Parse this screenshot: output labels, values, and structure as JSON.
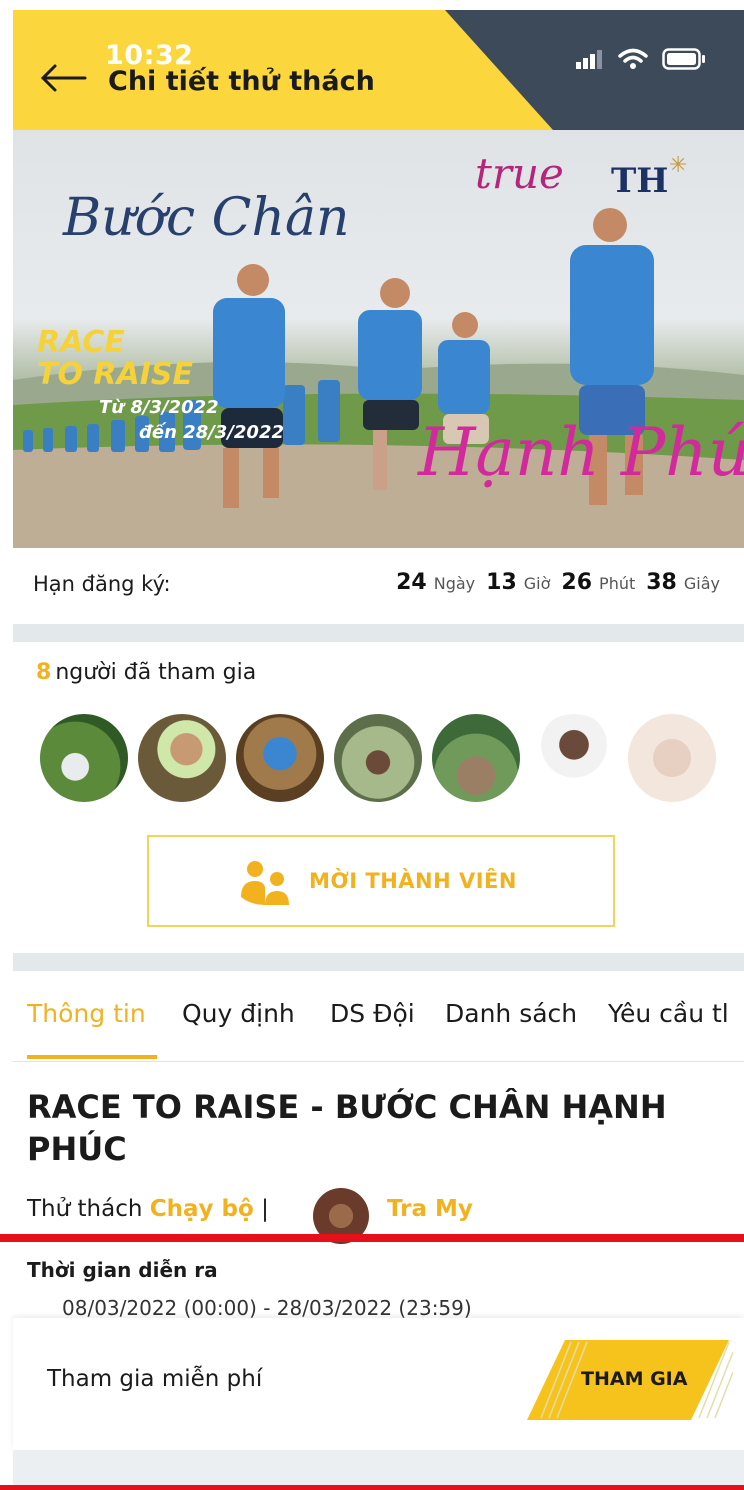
{
  "status_bar": {
    "time": "10:32"
  },
  "header": {
    "title": "Chi tiết thử thách"
  },
  "banner": {
    "title_script": "Bước Chân",
    "subtitle_script": "Hạnh Phúc",
    "race_line1": "RACE",
    "race_line2": "TO RAISE",
    "date_from": "Từ 8/3/2022",
    "date_to": "đến 28/3/2022",
    "logo_left": "true",
    "logo_right": "TH"
  },
  "countdown": {
    "label": "Hạn đăng ký:",
    "days": "24",
    "days_unit": "Ngày",
    "hours": "13",
    "hours_unit": "Giờ",
    "minutes": "26",
    "minutes_unit": "Phút",
    "seconds": "38",
    "seconds_unit": "Giây"
  },
  "participants": {
    "count": "8",
    "label": "người đã tham gia",
    "invite_label": "MỜI THÀNH VIÊN"
  },
  "tabs": [
    {
      "label": "Thông tin",
      "active": true
    },
    {
      "label": "Quy định",
      "active": false
    },
    {
      "label": "DS Đội",
      "active": false
    },
    {
      "label": "Danh sách",
      "active": false
    },
    {
      "label": "Yêu cầu tl",
      "active": false
    }
  ],
  "challenge": {
    "title": "RACE TO RAISE - BƯỚC CHÂN HẠNH PHÚC",
    "type_prefix": "Thử thách",
    "type": "Chạy bộ",
    "separator": "|",
    "author": "Tra My",
    "schedule_label": "Thời gian diễn ra",
    "schedule_value": "08/03/2022 (00:00) - 28/03/2022 (23:59)"
  },
  "bottom_bar": {
    "free_label": "Tham gia miễn phí",
    "join_label": "THAM GIA"
  },
  "colors": {
    "accent": "#f2b21f",
    "header_yellow": "#fbd63c",
    "header_dark": "#3c4a5a",
    "alert_red": "#e6101a"
  }
}
